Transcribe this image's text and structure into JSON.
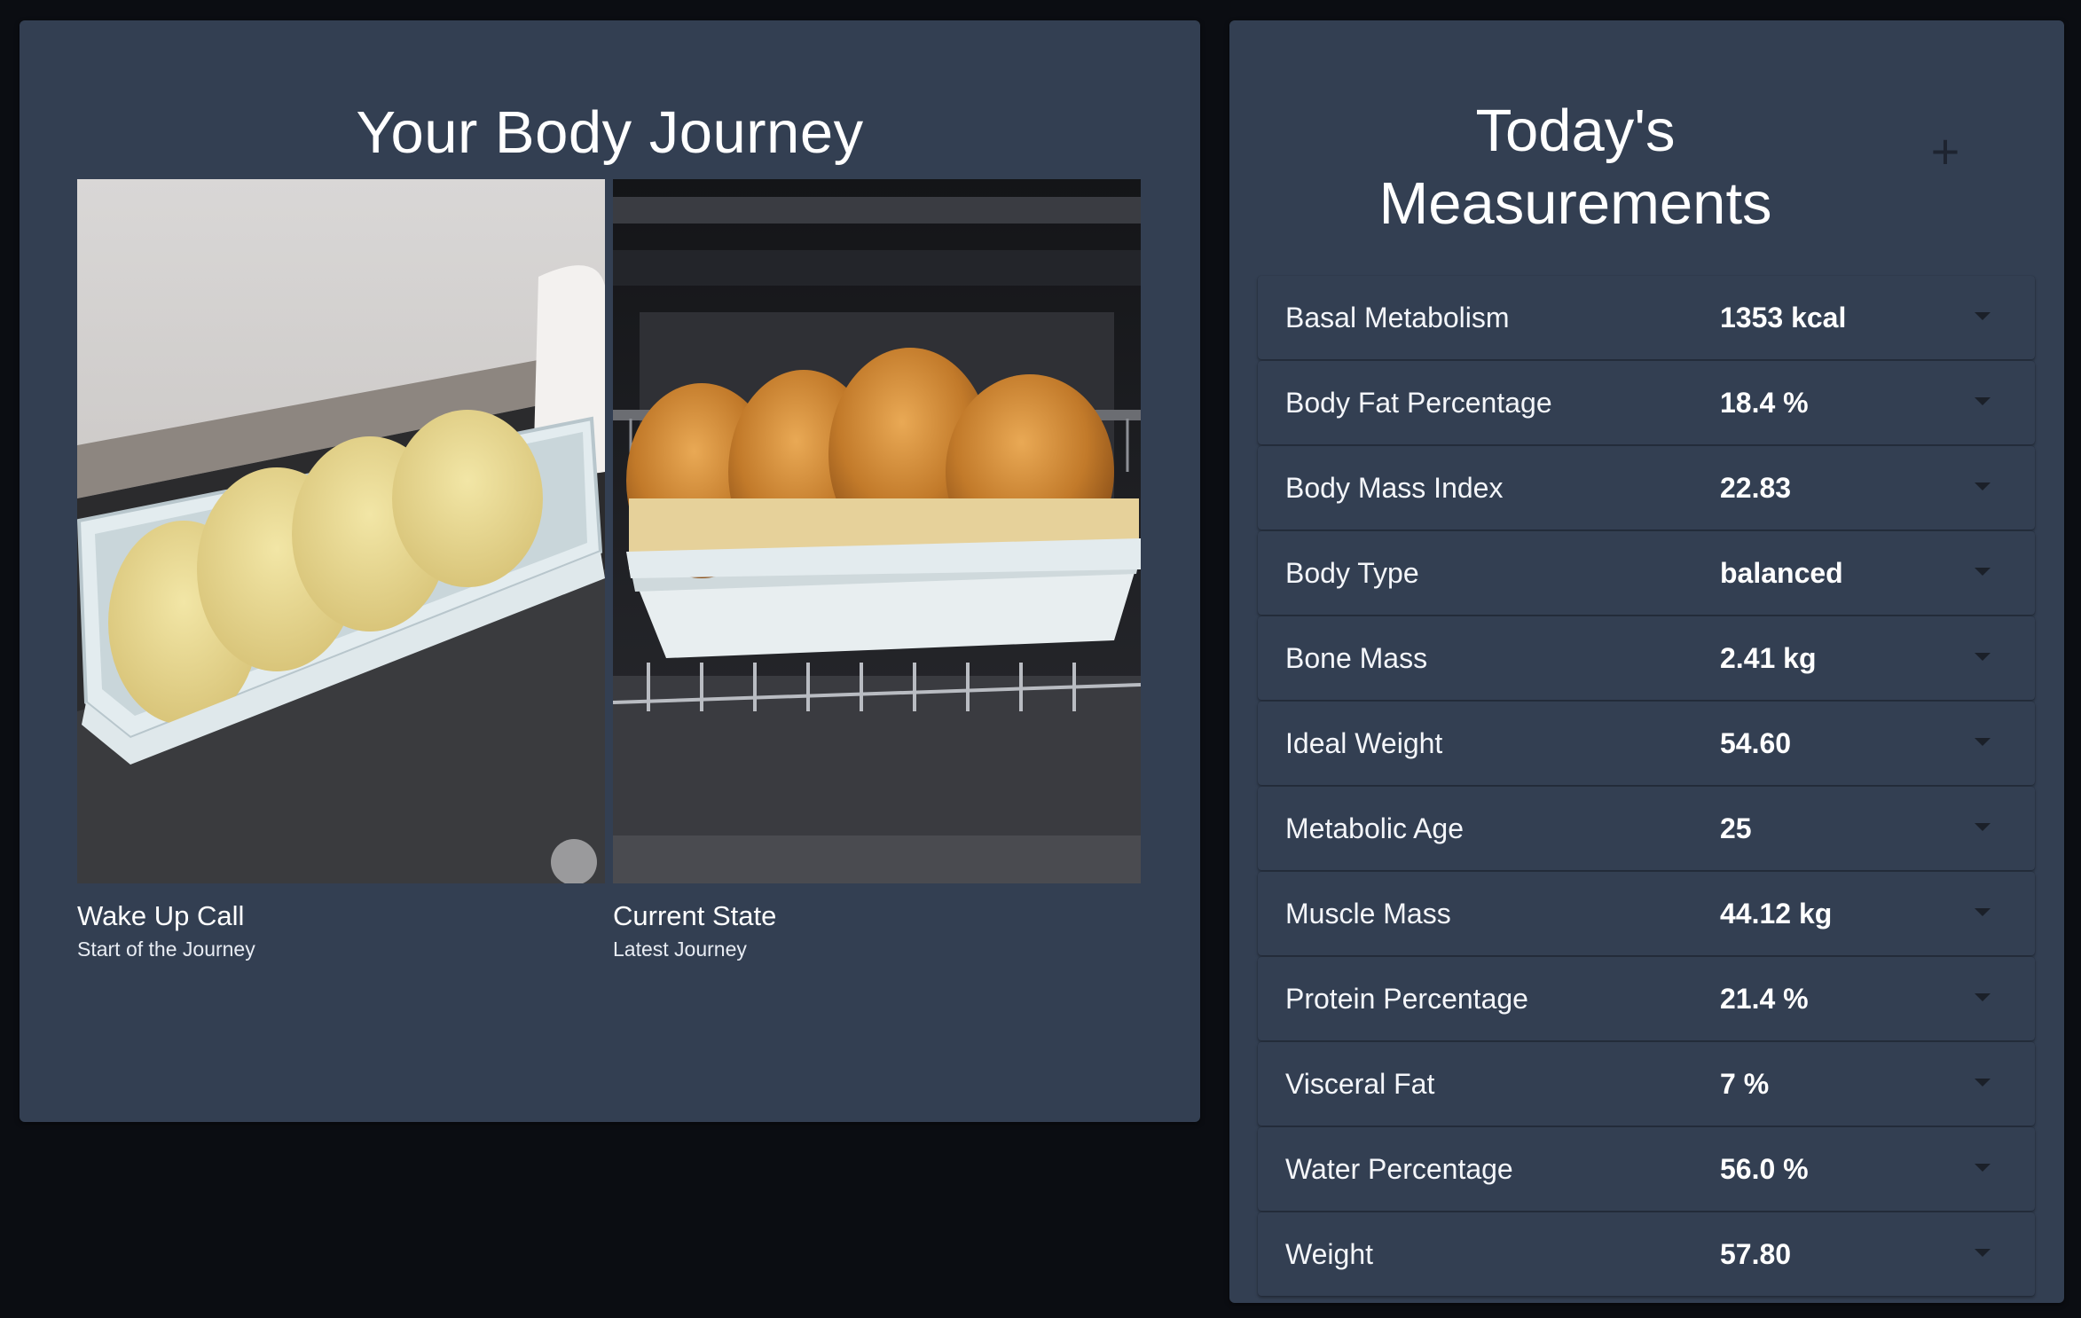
{
  "journey": {
    "title": "Your Body Journey",
    "photos": [
      {
        "title": "Wake Up Call",
        "subtitle": "Start of the Journey"
      },
      {
        "title": "Current State",
        "subtitle": "Latest Journey"
      }
    ]
  },
  "measurements": {
    "title": "Today's Measurements",
    "add_icon": "+",
    "rows": [
      {
        "label": "Basal Metabolism",
        "value": "1353 kcal"
      },
      {
        "label": "Body Fat Percentage",
        "value": "18.4 %"
      },
      {
        "label": "Body Mass Index",
        "value": "22.83"
      },
      {
        "label": "Body Type",
        "value": "balanced"
      },
      {
        "label": "Bone Mass",
        "value": "2.41 kg"
      },
      {
        "label": "Ideal Weight",
        "value": "54.60"
      },
      {
        "label": "Metabolic Age",
        "value": "25"
      },
      {
        "label": "Muscle Mass",
        "value": "44.12 kg"
      },
      {
        "label": "Protein Percentage",
        "value": "21.4 %"
      },
      {
        "label": "Visceral Fat",
        "value": "7 %"
      },
      {
        "label": "Water Percentage",
        "value": "56.0 %"
      },
      {
        "label": "Weight",
        "value": "57.80"
      }
    ]
  },
  "colors": {
    "page_background": "#0b0d12",
    "card_background": "#333f52",
    "text": "#ffffff"
  }
}
